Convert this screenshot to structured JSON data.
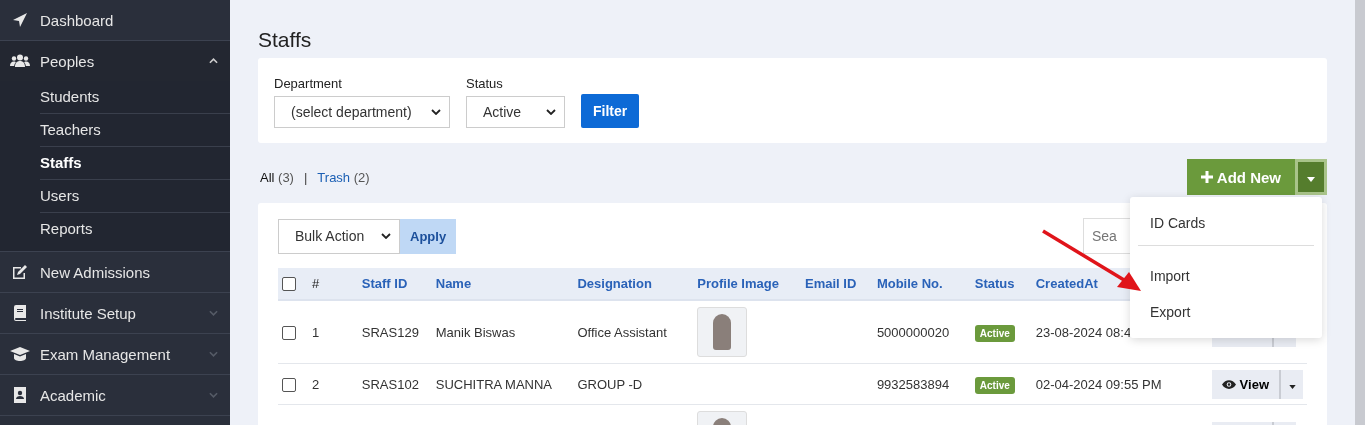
{
  "sidebar": {
    "items": [
      {
        "label": "Dashboard",
        "selected": false
      },
      {
        "label": "Peoples",
        "selected": false,
        "expanded": true,
        "children": [
          {
            "label": "Students",
            "selected": false
          },
          {
            "label": "Teachers",
            "selected": false
          },
          {
            "label": "Staffs",
            "selected": true
          },
          {
            "label": "Users",
            "selected": false
          },
          {
            "label": "Reports",
            "selected": false
          }
        ]
      },
      {
        "label": "New Admissions",
        "selected": false
      },
      {
        "label": "Institute Setup",
        "selected": false,
        "expanded": false
      },
      {
        "label": "Exam Management",
        "selected": false,
        "expanded": false
      },
      {
        "label": "Academic",
        "selected": false,
        "expanded": false
      }
    ]
  },
  "page_title": "Staffs",
  "filters": {
    "department": {
      "label": "Department",
      "value": "(select department)"
    },
    "status": {
      "label": "Status",
      "value": "Active"
    },
    "button": "Filter"
  },
  "views_separator": "|",
  "views": [
    {
      "label": "All",
      "count": "(3)",
      "selected": true
    },
    {
      "label": "Trash",
      "count": "(2)",
      "selected": false
    }
  ],
  "add_button": "Add New",
  "bulk": {
    "value": "Bulk Action",
    "button": "Apply"
  },
  "search": {
    "placeholder": "Sea"
  },
  "table": {
    "select_all_checked": false,
    "columns": [
      "#",
      "Staff ID",
      "Name",
      "Designation",
      "Profile Image",
      "Email ID",
      "Mobile No.",
      "Status",
      "CreatedAt"
    ],
    "rows": [
      {
        "checked": false,
        "index": "1",
        "staff_id": "SRAS129",
        "name": "Manik Biswas",
        "designation": "Office Assistant",
        "photo": true,
        "mobile": "5000000020",
        "status": "Active",
        "created": "23-08-2024 08:4",
        "action": ""
      },
      {
        "checked": false,
        "index": "2",
        "staff_id": "SRAS102",
        "name": "SUCHITRA MANNA",
        "designation": "GROUP -D",
        "photo": false,
        "mobile": "9932583894",
        "status": "Active",
        "created": "02-04-2024 09:55 PM",
        "action": "View"
      },
      {
        "photo": true,
        "action": ""
      }
    ]
  },
  "menu": {
    "items": [
      {
        "label": "ID Cards",
        "divider_after": true
      },
      {
        "label": "Import",
        "divider_after": false
      },
      {
        "label": "Export",
        "divider_after": false
      }
    ]
  }
}
